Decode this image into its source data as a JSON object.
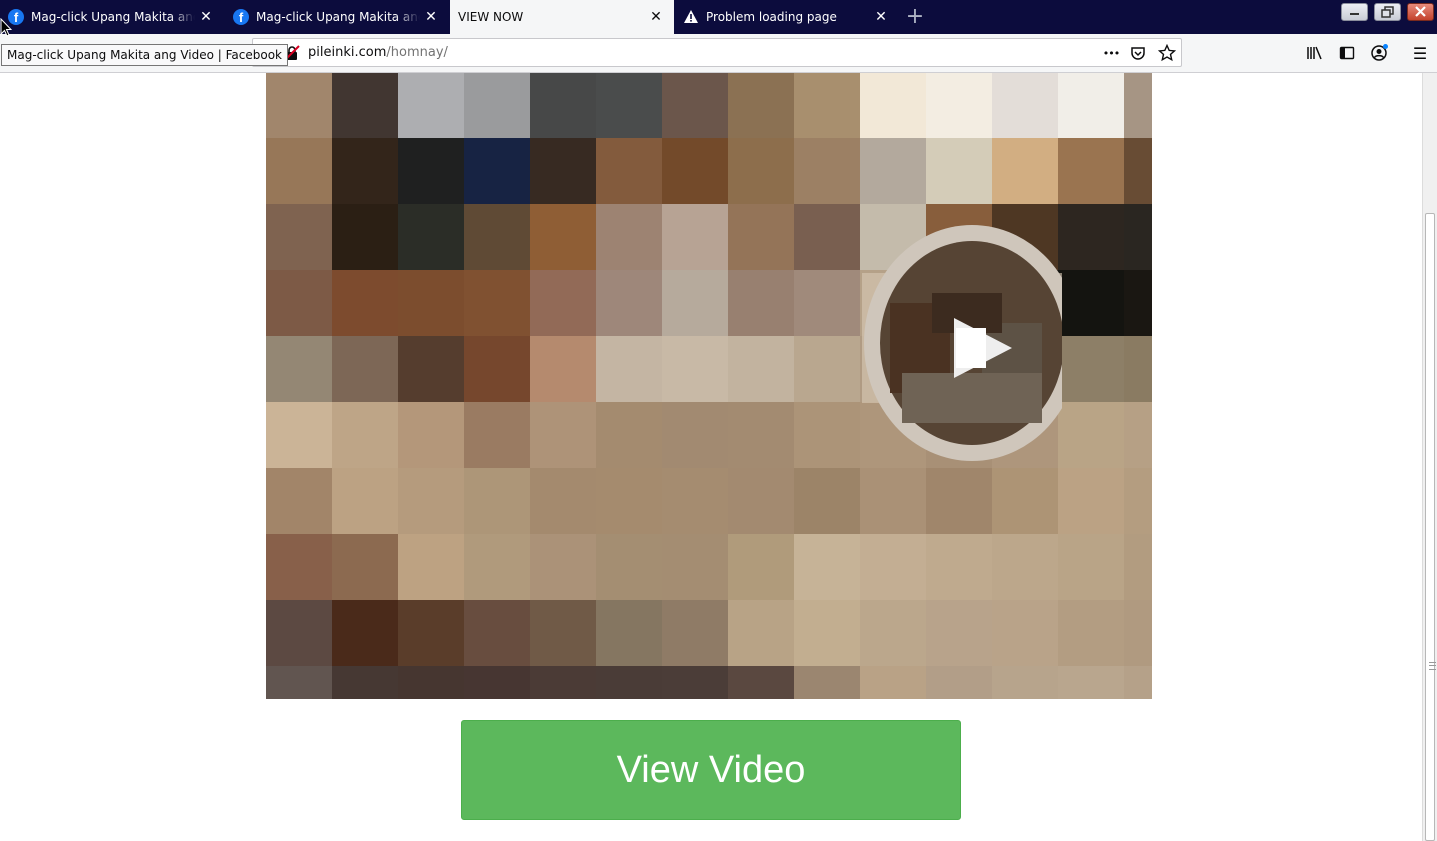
{
  "browser": {
    "tabs": [
      {
        "title": "Mag-click Upang Makita ang Video | Facebook",
        "icon": "facebook-icon",
        "active": false
      },
      {
        "title": "Mag-click Upang Makita ang Video | Facebook",
        "icon": "facebook-icon",
        "active": false
      },
      {
        "title": "VIEW NOW",
        "icon": "none",
        "active": true
      },
      {
        "title": "Problem loading page",
        "icon": "warning-icon",
        "active": false
      }
    ],
    "tab_close_glyph": "✕",
    "new_tab_glyph": "+",
    "url": {
      "domain": "pileinki.com",
      "path": "/homnay/"
    },
    "tooltip": "Mag-click Upang Makita ang Video | Facebook",
    "page_actions_glyph": "•••",
    "menu_glyph": "☰"
  },
  "page": {
    "video_thumbnail": "pixelated-video-thumbnail",
    "button_label": "View Video",
    "button_color": "#5cb85c"
  },
  "colors": {
    "tabbar": "#0c0c3d",
    "active_tab": "#f5f6f7",
    "facebook_blue": "#1877f2"
  }
}
